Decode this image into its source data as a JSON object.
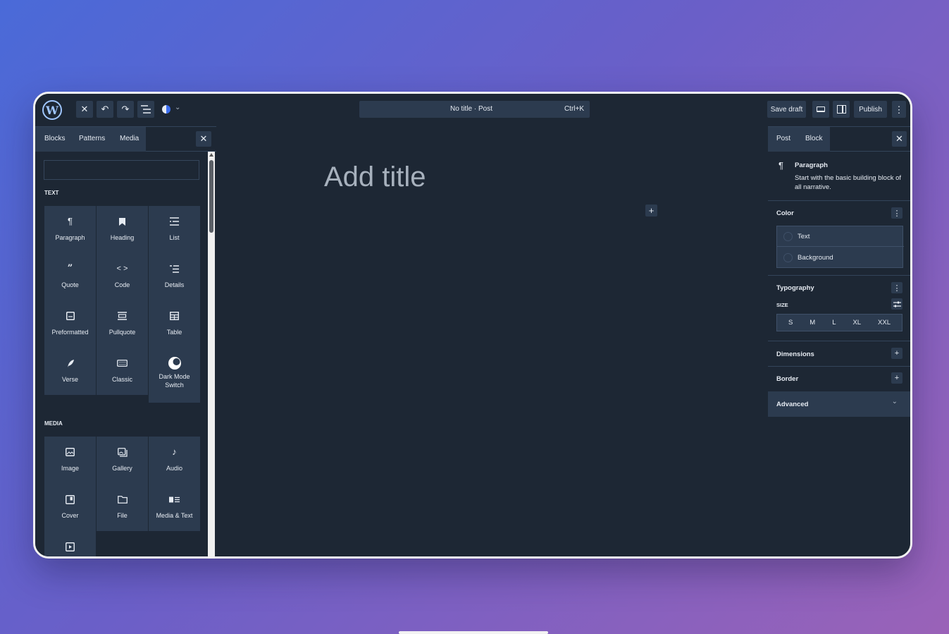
{
  "topbar": {
    "logo": "W",
    "close_icon": "✕",
    "undo_icon": "↶",
    "redo_icon": "↷",
    "doc_title": "No title · Post",
    "shortcut": "Ctrl+K",
    "save_draft": "Save draft",
    "publish": "Publish"
  },
  "inserter": {
    "tabs": [
      "Blocks",
      "Patterns",
      "Media"
    ],
    "search_placeholder": "",
    "sections": [
      {
        "label": "TEXT",
        "blocks": [
          {
            "label": "Paragraph",
            "icon": "paragraph-icon"
          },
          {
            "label": "Heading",
            "icon": "bookmark-icon"
          },
          {
            "label": "List",
            "icon": "list-icon"
          },
          {
            "label": "Quote",
            "icon": "quote-icon"
          },
          {
            "label": "Code",
            "icon": "code-icon"
          },
          {
            "label": "Details",
            "icon": "details-icon"
          },
          {
            "label": "Preformatted",
            "icon": "preformatted-icon"
          },
          {
            "label": "Pullquote",
            "icon": "pullquote-icon"
          },
          {
            "label": "Table",
            "icon": "table-icon"
          },
          {
            "label": "Verse",
            "icon": "feather-icon"
          },
          {
            "label": "Classic",
            "icon": "keyboard-icon"
          },
          {
            "label": "Dark Mode Switch",
            "icon": "dark-mode-icon"
          }
        ]
      },
      {
        "label": "MEDIA",
        "blocks": [
          {
            "label": "Image",
            "icon": "image-icon"
          },
          {
            "label": "Gallery",
            "icon": "gallery-icon"
          },
          {
            "label": "Audio",
            "icon": "audio-icon"
          },
          {
            "label": "Cover",
            "icon": "cover-icon"
          },
          {
            "label": "File",
            "icon": "folder-icon"
          },
          {
            "label": "Media & Text",
            "icon": "media-text-icon"
          },
          {
            "label": "",
            "icon": "video-icon"
          }
        ]
      }
    ]
  },
  "canvas": {
    "title_placeholder": "Add title"
  },
  "settings": {
    "tabs": [
      "Post",
      "Block"
    ],
    "block_name": "Paragraph",
    "block_description": "Start with the basic building block of all narrative.",
    "color": {
      "heading": "Color",
      "items": [
        "Text",
        "Background"
      ]
    },
    "typography": {
      "heading": "Typography",
      "size_label": "SIZE",
      "sizes": [
        "S",
        "M",
        "L",
        "XL",
        "XXL"
      ]
    },
    "dimensions": "Dimensions",
    "border": "Border",
    "advanced": "Advanced"
  },
  "colors": {
    "background_panel": "#1d2734",
    "button": "#2c3b4f",
    "text": "#e6ebf2",
    "title_placeholder": "#a7b1bd"
  }
}
